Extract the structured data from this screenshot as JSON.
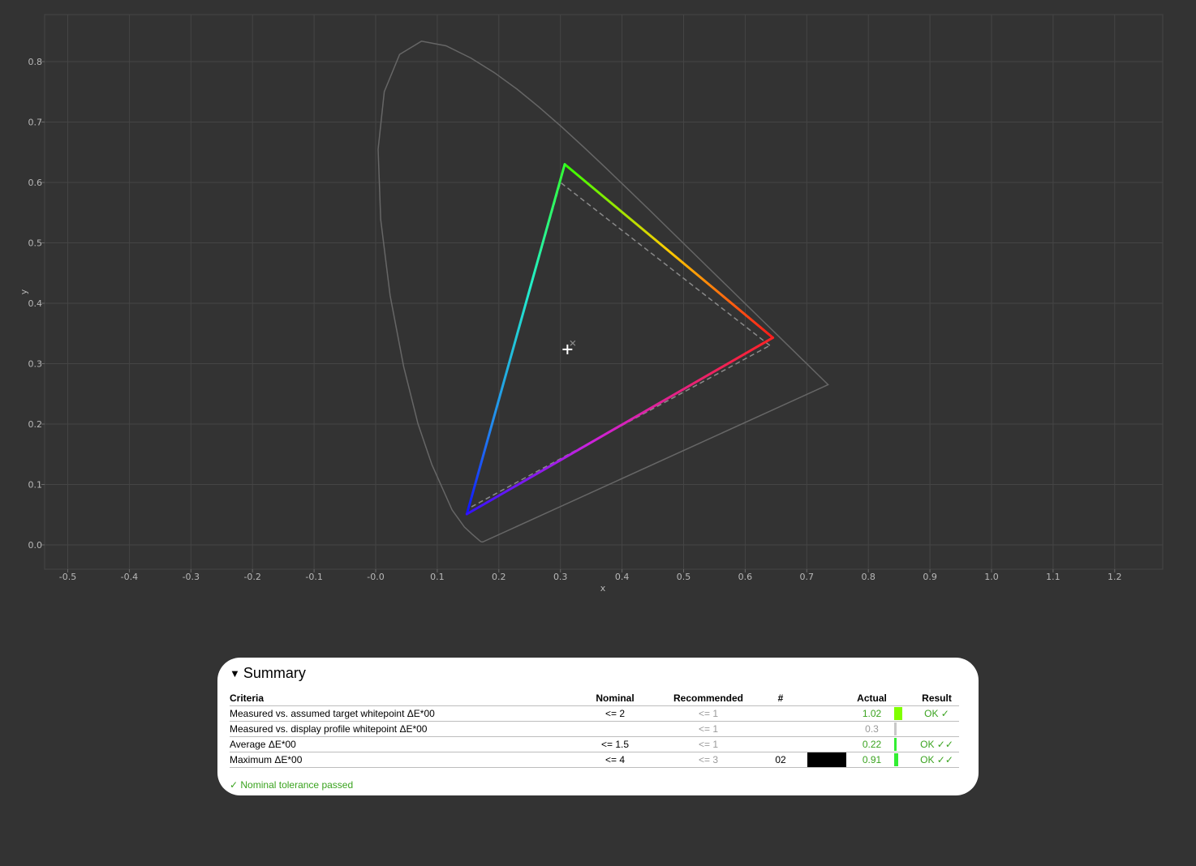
{
  "chart_data": {
    "type": "scatter",
    "xlabel": "x",
    "ylabel": "y",
    "xlim": [
      -0.5,
      1.2
    ],
    "ylim": [
      0.0,
      0.8
    ],
    "x_ticks": [
      "-0.5",
      "-0.4",
      "-0.3",
      "-0.2",
      "-0.1",
      "-0.0",
      "0.1",
      "0.2",
      "0.3",
      "0.4",
      "0.5",
      "0.6",
      "0.7",
      "0.8",
      "0.9",
      "1.0",
      "1.1",
      "1.2"
    ],
    "y_ticks": [
      "0.0",
      "0.1",
      "0.2",
      "0.3",
      "0.4",
      "0.5",
      "0.6",
      "0.7",
      "0.8"
    ],
    "grid": true,
    "spectral_locus": [
      [
        0.1741,
        0.005
      ],
      [
        0.1738,
        0.0049
      ],
      [
        0.1736,
        0.0049
      ],
      [
        0.173,
        0.0048
      ],
      [
        0.1714,
        0.0051
      ],
      [
        0.1689,
        0.0069
      ],
      [
        0.1644,
        0.0109
      ],
      [
        0.1566,
        0.0177
      ],
      [
        0.144,
        0.0297
      ],
      [
        0.1241,
        0.0578
      ],
      [
        0.0913,
        0.1327
      ],
      [
        0.0687,
        0.2007
      ],
      [
        0.0454,
        0.295
      ],
      [
        0.0235,
        0.4127
      ],
      [
        0.0082,
        0.5384
      ],
      [
        0.0039,
        0.6548
      ],
      [
        0.0139,
        0.7502
      ],
      [
        0.0389,
        0.812
      ],
      [
        0.0743,
        0.8338
      ],
      [
        0.1142,
        0.8262
      ],
      [
        0.1547,
        0.8059
      ],
      [
        0.1929,
        0.7816
      ],
      [
        0.2296,
        0.7543
      ],
      [
        0.2658,
        0.7243
      ],
      [
        0.3016,
        0.6923
      ],
      [
        0.3373,
        0.6589
      ],
      [
        0.3731,
        0.6245
      ],
      [
        0.4087,
        0.5896
      ],
      [
        0.4441,
        0.5547
      ],
      [
        0.4788,
        0.5202
      ],
      [
        0.5125,
        0.4866
      ],
      [
        0.5448,
        0.4544
      ],
      [
        0.5752,
        0.4242
      ],
      [
        0.6029,
        0.3965
      ],
      [
        0.627,
        0.3725
      ],
      [
        0.6482,
        0.3514
      ],
      [
        0.6658,
        0.334
      ],
      [
        0.6801,
        0.3197
      ],
      [
        0.6915,
        0.3083
      ],
      [
        0.7006,
        0.2993
      ],
      [
        0.7079,
        0.292
      ],
      [
        0.714,
        0.2859
      ],
      [
        0.7347,
        0.2653
      ]
    ],
    "measured_gamut": {
      "red": [
        0.645,
        0.343
      ],
      "green": [
        0.307,
        0.63
      ],
      "blue": [
        0.148,
        0.051
      ]
    },
    "reference_gamut": {
      "red": [
        0.64,
        0.33
      ],
      "green": [
        0.3,
        0.6
      ],
      "blue": [
        0.15,
        0.06
      ]
    },
    "measured_whitepoint": [
      0.3127,
      0.329
    ],
    "target_whitepoint": [
      0.32,
      0.334
    ]
  },
  "summary": {
    "toggle": "▼",
    "title": "Summary",
    "columns": {
      "criteria": "Criteria",
      "nominal": "Nominal",
      "recommended": "Recommended",
      "num": "#",
      "actual": "Actual",
      "result": "Result"
    },
    "rows": [
      {
        "criteria": "Measured vs. assumed target whitepoint ΔE*00",
        "nominal": "<= 2",
        "recommended": "<= 1",
        "num": "",
        "actual": "1.02",
        "actual_fraction": 0.51,
        "result": "OK ✓",
        "status": "ok",
        "bar_color": "#80ff00"
      },
      {
        "criteria": "Measured vs. display profile whitepoint ΔE*00",
        "nominal": "",
        "recommended": "<= 1",
        "num": "",
        "actual": "0.3",
        "actual_fraction": 0.15,
        "result": "",
        "status": "info",
        "bar_color": "#c8c8c8"
      },
      {
        "criteria": "Average ΔE*00",
        "nominal": "<= 1.5",
        "recommended": "<= 1",
        "num": "",
        "actual": "0.22",
        "actual_fraction": 0.15,
        "result": "OK ✓✓",
        "status": "ok",
        "bar_color": "#33ee33"
      },
      {
        "criteria": "Maximum ΔE*00",
        "nominal": "<= 4",
        "recommended": "<= 3",
        "num": "02",
        "swatch": "#000000",
        "actual": "0.91",
        "actual_fraction": 0.23,
        "result": "OK ✓✓",
        "status": "ok",
        "bar_color": "#33ee33"
      }
    ],
    "footnote": "✓ Nominal tolerance passed"
  }
}
